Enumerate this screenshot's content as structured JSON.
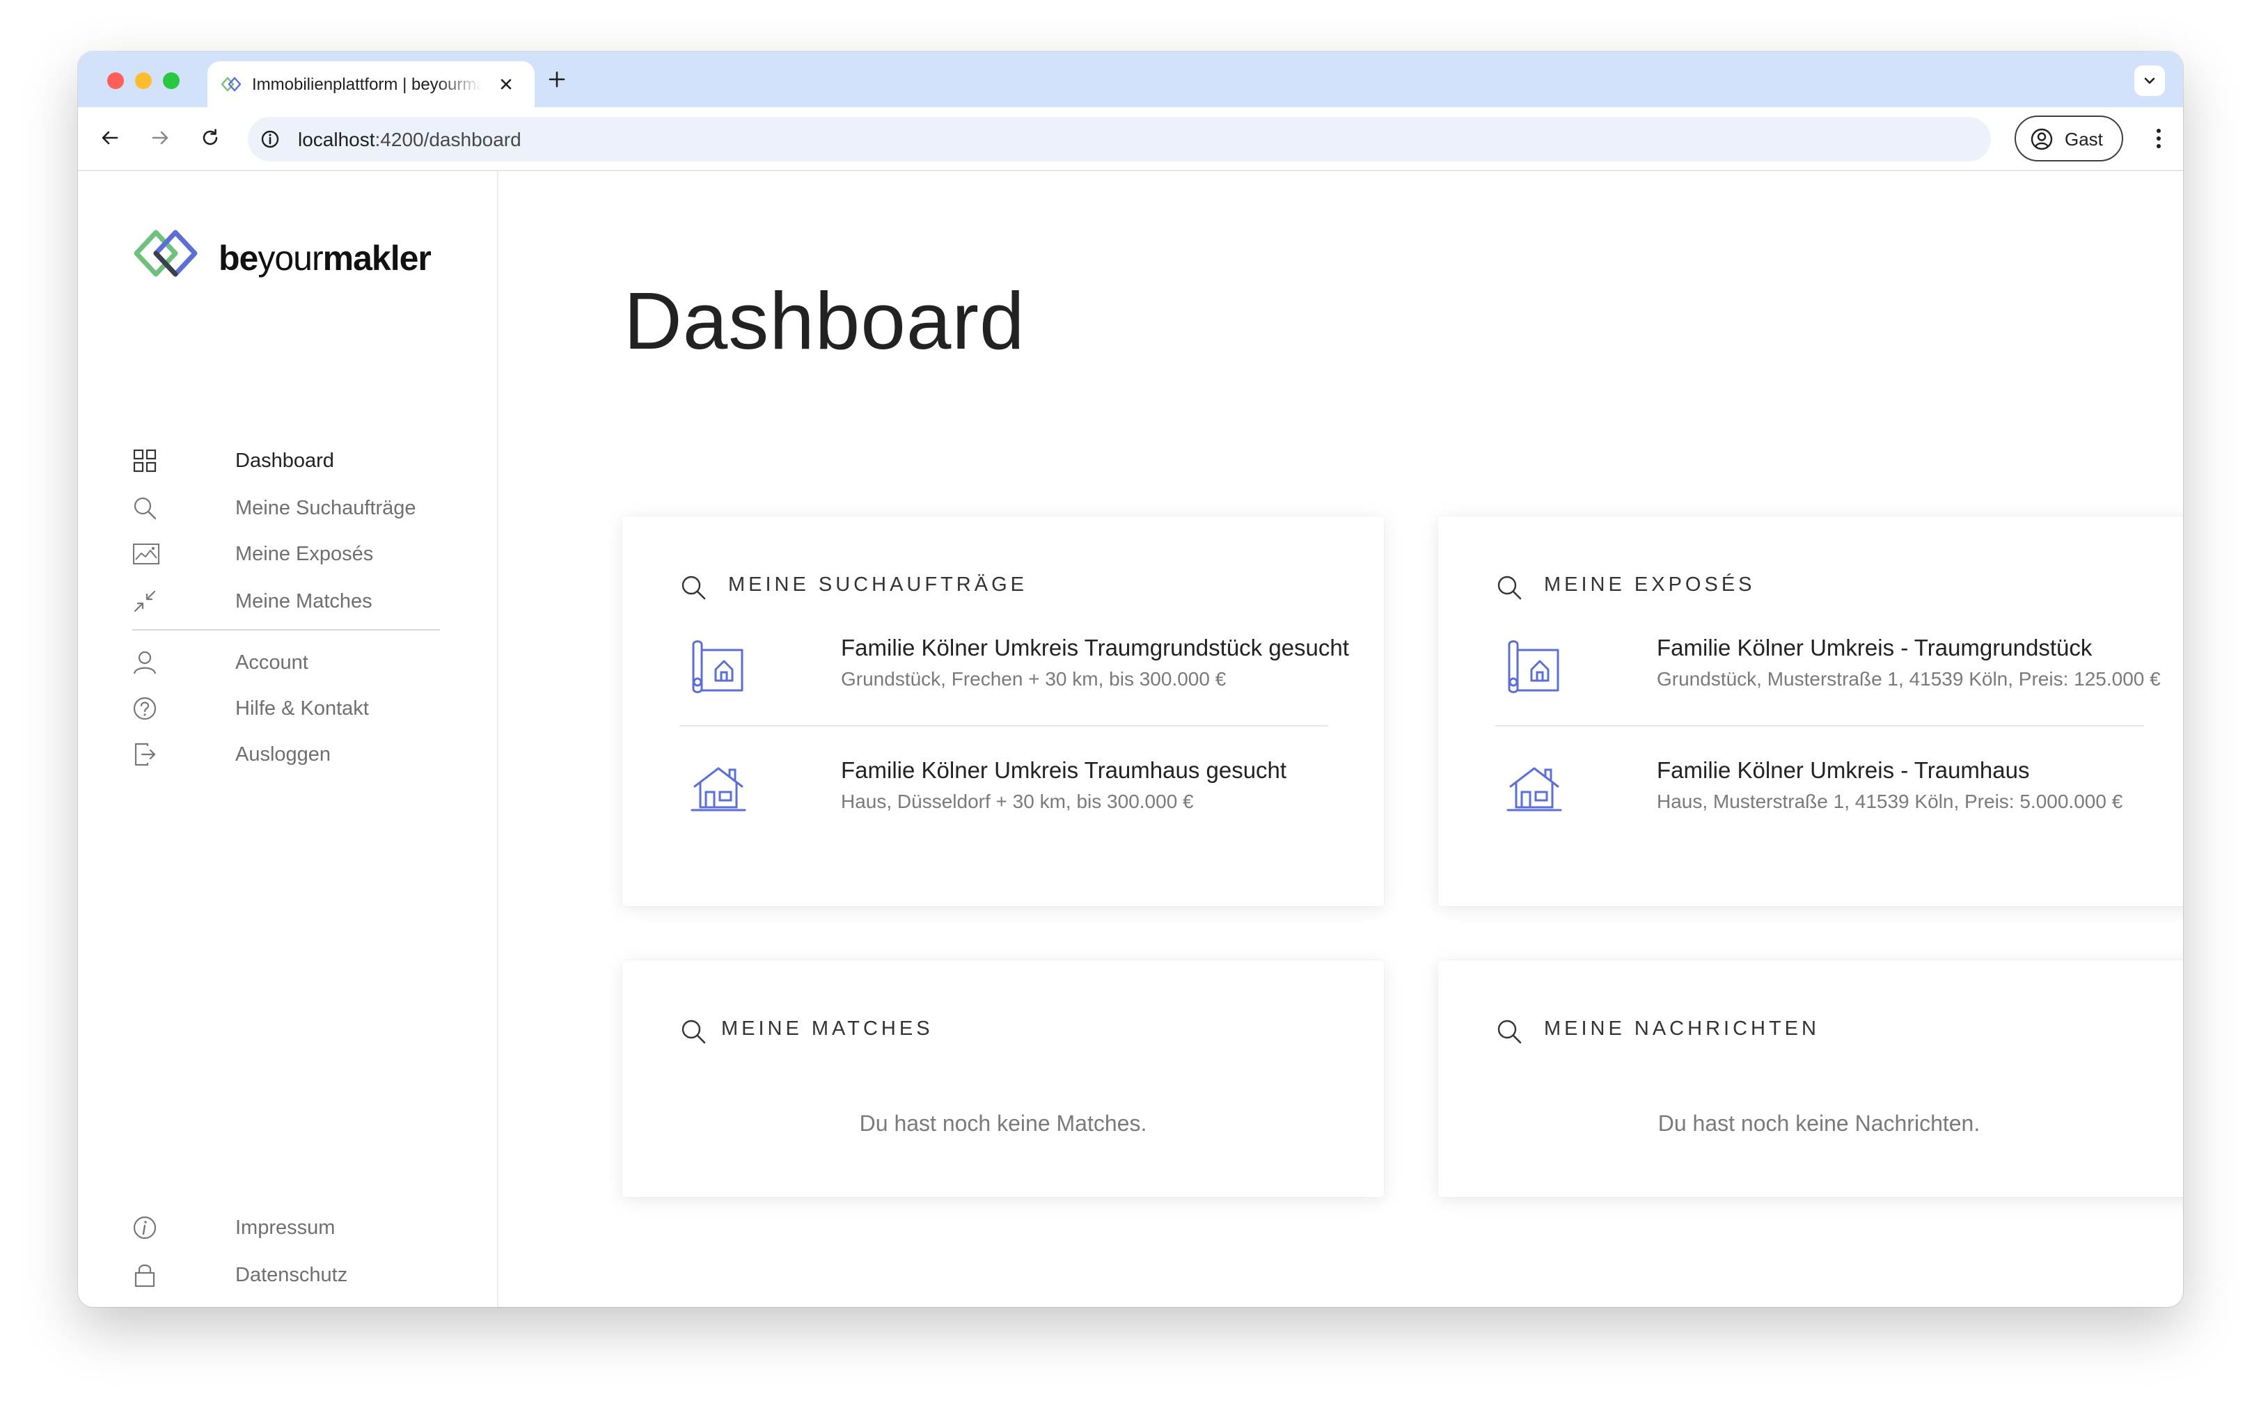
{
  "browser": {
    "tab_title": "Immobilienplattform | beyourmakler",
    "url_host": "localhost",
    "url_path": ":4200/dashboard",
    "profile_label": "Gast"
  },
  "brand": {
    "logo_bold": "be",
    "logo_light": "your",
    "logo_bold2": "makler",
    "colors": {
      "accent_blue": "#5b6fd6",
      "accent_green": "#6fbf7d",
      "logo_dark": "#3b3f4a"
    }
  },
  "sidebar": {
    "items": [
      {
        "label": "Dashboard",
        "icon": "grid-icon"
      },
      {
        "label": "Meine Suchaufträge",
        "icon": "search-icon"
      },
      {
        "label": "Meine Exposés",
        "icon": "image-icon"
      },
      {
        "label": "Meine Matches",
        "icon": "arrows-in-icon"
      }
    ],
    "account_items": [
      {
        "label": "Account",
        "icon": "user-icon"
      },
      {
        "label": "Hilfe & Kontakt",
        "icon": "help-icon"
      },
      {
        "label": "Ausloggen",
        "icon": "logout-icon"
      }
    ],
    "footer_items": [
      {
        "label": "Impressum",
        "icon": "info-icon"
      },
      {
        "label": "Datenschutz",
        "icon": "lock-icon"
      }
    ]
  },
  "main": {
    "title": "Dashboard",
    "cards": {
      "searches": {
        "title": "MEINE SUCHAUFTRÄGE",
        "entries": [
          {
            "title": "Familie Kölner Umkreis Traumgrundstück gesucht",
            "subtitle": "Grundstück, Frechen + 30 km, bis 300.000 €",
            "icon": "plot-icon"
          },
          {
            "title": "Familie Kölner Umkreis Traumhaus gesucht",
            "subtitle": "Haus, Düsseldorf + 30 km, bis 300.000 €",
            "icon": "house-icon"
          }
        ]
      },
      "exposes": {
        "title": "MEINE EXPOSÉS",
        "entries": [
          {
            "title": "Familie Kölner Umkreis - Traumgrundstück",
            "subtitle": "Grundstück, Musterstraße 1, 41539 Köln, Preis: 125.000 €",
            "icon": "plot-icon"
          },
          {
            "title": "Familie Kölner Umkreis - Traumhaus",
            "subtitle": "Haus, Musterstraße 1, 41539 Köln, Preis: 5.000.000 €",
            "icon": "house-icon"
          }
        ]
      },
      "matches": {
        "title": "MEINE MATCHES",
        "empty": "Du hast noch keine Matches."
      },
      "messages": {
        "title": "MEINE NACHRICHTEN",
        "empty": "Du hast noch keine Nachrichten."
      }
    }
  }
}
